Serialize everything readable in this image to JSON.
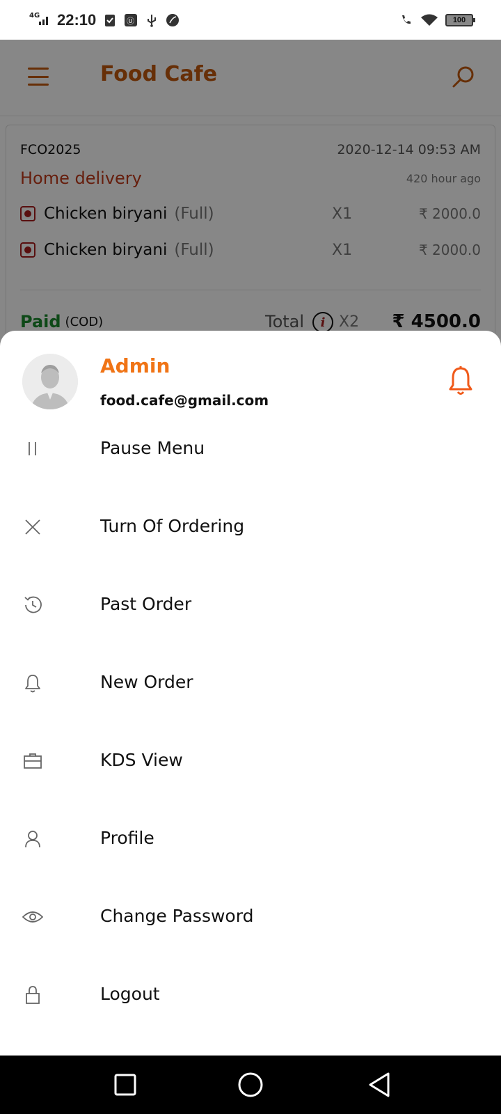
{
  "status_bar": {
    "time": "22:10",
    "network": "4G",
    "battery": "100"
  },
  "app": {
    "title": "Food Cafe",
    "order": {
      "id": "FCO2025",
      "datetime": "2020-12-14 09:53 AM",
      "type": "Home delivery",
      "ago": "420 hour ago",
      "items": [
        {
          "name": "Chicken biryani",
          "variant": "(Full)",
          "qty": "X1",
          "price": "₹ 2000.0"
        },
        {
          "name": "Chicken biryani",
          "variant": "(Full)",
          "qty": "X1",
          "price": "₹ 2000.0"
        }
      ],
      "payment_status": "Paid",
      "payment_method": "(COD)",
      "total_label": "Total",
      "total_qty": "X2",
      "total_amount": "₹ 4500.0"
    }
  },
  "drawer": {
    "user_name": "Admin",
    "user_email": "food.cafe@gmail.com",
    "menu": [
      {
        "label": "Pause Menu",
        "icon": "pause-icon"
      },
      {
        "label": "Turn Of Ordering",
        "icon": "close-icon"
      },
      {
        "label": "Past Order",
        "icon": "history-icon"
      },
      {
        "label": "New Order",
        "icon": "bell-icon"
      },
      {
        "label": "KDS View",
        "icon": "briefcase-icon"
      },
      {
        "label": "Profile",
        "icon": "user-icon"
      },
      {
        "label": "Change Password",
        "icon": "eye-icon"
      },
      {
        "label": "Logout",
        "icon": "lock-icon"
      }
    ]
  },
  "colors": {
    "accent": "#f07416",
    "brand_dark": "#c35a0f",
    "delivery": "#c0391a",
    "paid": "#1c8a2e"
  }
}
